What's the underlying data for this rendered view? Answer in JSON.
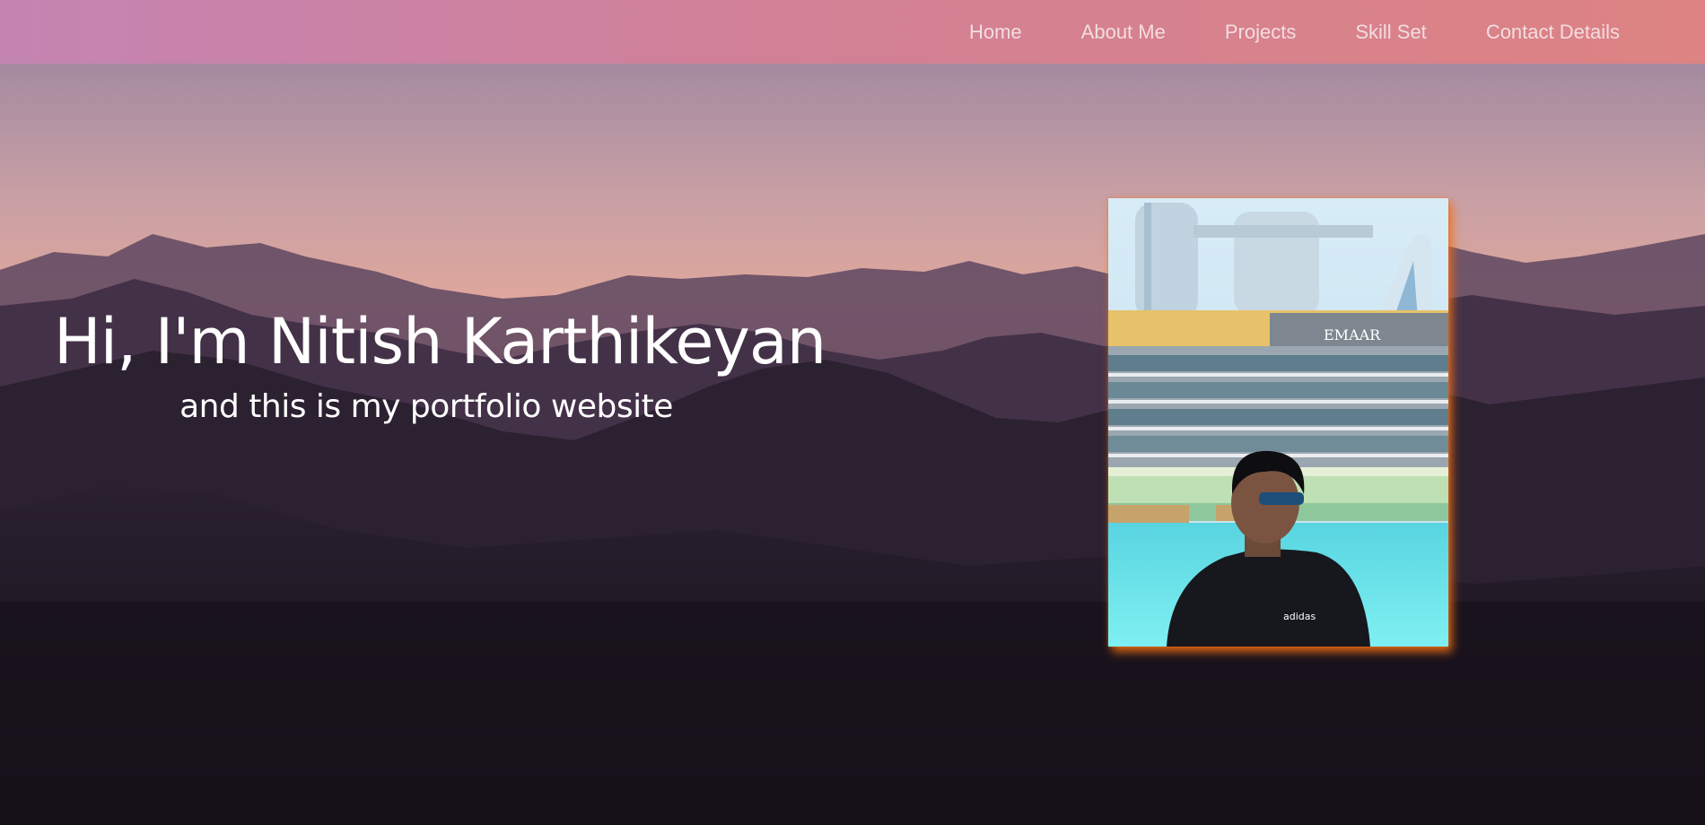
{
  "nav": {
    "items": [
      {
        "label": "Home"
      },
      {
        "label": "About Me"
      },
      {
        "label": "Projects"
      },
      {
        "label": "Skill Set"
      },
      {
        "label": "Contact Details"
      }
    ]
  },
  "hero": {
    "title": "Hi, I'm Nitish Karthikeyan",
    "subtitle": "and this is my portfolio website"
  },
  "photo": {
    "sign_text": "EMAAR",
    "shirt_logo_text": "adidas"
  },
  "colors": {
    "nav_start": "#c484b2",
    "nav_end": "#dd8383",
    "nav_text": "#f3dde0",
    "photo_glow": "#f06e14",
    "hero_text": "#ffffff"
  }
}
